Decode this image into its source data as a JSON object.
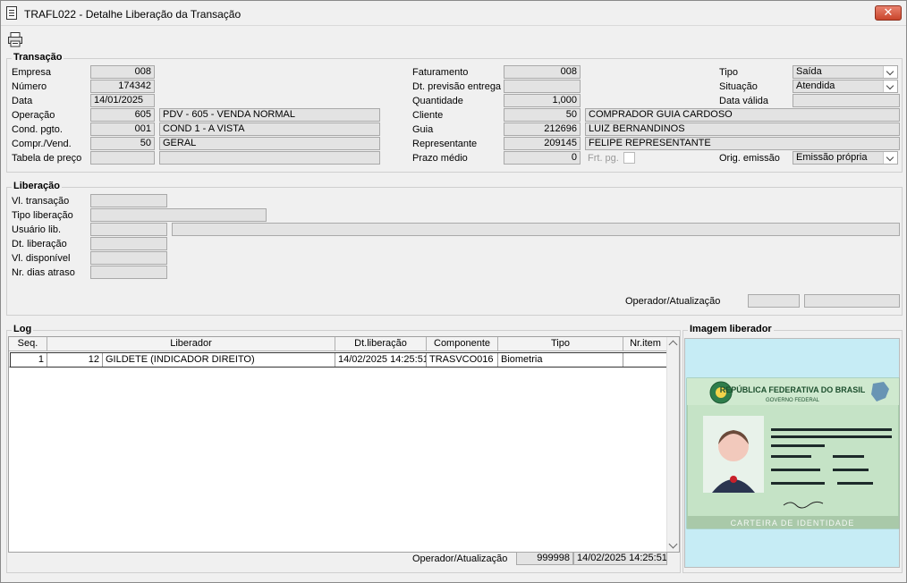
{
  "window": {
    "title": "TRAFL022 - Detalhe Liberação da Transação",
    "close_label": "✕"
  },
  "transacao": {
    "group_title": "Transação",
    "empresa_label": "Empresa",
    "empresa": "008",
    "numero_label": "Número",
    "numero": "174342",
    "data_label": "Data",
    "data": "14/01/2025",
    "operacao_label": "Operação",
    "operacao_code": "605",
    "operacao_desc": "PDV - 605 - VENDA NORMAL",
    "cond_label": "Cond. pgto.",
    "cond_code": "001",
    "cond_desc": "COND 1 - A VISTA",
    "compr_label": "Compr./Vend.",
    "compr_code": "50",
    "compr_desc": "GERAL",
    "tabela_label": "Tabela de preço",
    "tabela_code": "",
    "tabela_desc": "",
    "faturamento_label": "Faturamento",
    "faturamento": "008",
    "dtprev_label": "Dt. previsão entrega",
    "dtprev": "",
    "quantidade_label": "Quantidade",
    "quantidade": "1,000",
    "cliente_label": "Cliente",
    "cliente_code": "50",
    "cliente_desc": "COMPRADOR GUIA CARDOSO",
    "guia_label": "Guia",
    "guia_code": "212696",
    "guia_desc": "LUIZ BERNANDINOS",
    "repr_label": "Representante",
    "repr_code": "209145",
    "repr_desc": "FELIPE REPRESENTANTE",
    "prazo_label": "Prazo médio",
    "prazo": "0",
    "frtpg_label": "Frt. pg.",
    "tipo_label": "Tipo",
    "tipo": "Saída",
    "situacao_label": "Situação",
    "situacao": "Atendida",
    "datavalida_label": "Data válida",
    "datavalida": "",
    "origem_label": "Orig. emissão",
    "origem": "Emissão própria"
  },
  "liberacao": {
    "group_title": "Liberação",
    "vltrans_label": "Vl. transação",
    "vltrans": "",
    "tipolib_label": "Tipo liberação",
    "tipolib": "",
    "usuario_label": "Usuário lib.",
    "usuario_code": "",
    "usuario_desc": "",
    "dtlib_label": "Dt. liberação",
    "dtlib": "",
    "vldisp_label": "Vl. disponível",
    "vldisp": "",
    "nrdias_label": "Nr. dias atraso",
    "nrdias": "",
    "operador_label": "Operador/Atualização",
    "operador": "",
    "atualizacao": ""
  },
  "log": {
    "group_title": "Log",
    "columns": [
      "Seq.",
      "Liberador",
      "Dt.liberação",
      "Componente",
      "Tipo",
      "Nr.item"
    ],
    "rows": [
      {
        "seq": "1",
        "lib_code": "12",
        "lib_name": "GILDETE (INDICADOR DIREITO)",
        "dt": "14/02/2025 14:25:51",
        "componente": "TRASVCO016",
        "tipo": "Biometria",
        "nritem": ""
      }
    ],
    "operador_label": "Operador/Atualização",
    "operador": "999998",
    "atualizacao": "14/02/2025 14:25:51"
  },
  "imagem": {
    "group_title": "Imagem liberador",
    "card_country": "REPÚBLICA FEDERATIVA DO BRASIL",
    "card_gov": "GOVERNO FEDERAL",
    "card_footer": "CARTEIRA DE IDENTIDADE"
  },
  "colors": {
    "field_bg": "#e3e3e3",
    "window_bg": "#f0f0f0",
    "image_bg": "#c6ecf5"
  }
}
